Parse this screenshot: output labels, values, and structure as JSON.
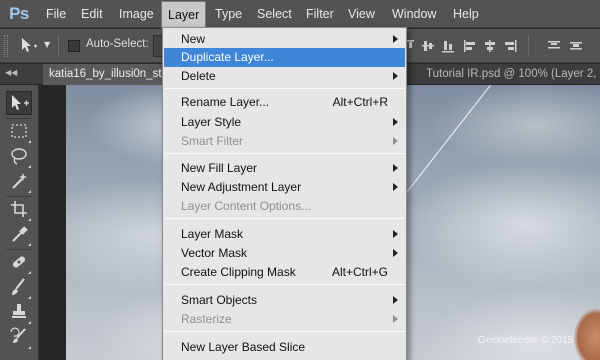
{
  "menubar": {
    "logo": "Ps",
    "items": [
      "File",
      "Edit",
      "Image",
      "Layer",
      "Type",
      "Select",
      "Filter",
      "View",
      "Window",
      "Help"
    ],
    "active": "Layer"
  },
  "options_bar": {
    "auto_select_label": "Auto-Select:"
  },
  "tabs": [
    {
      "label": "katia16_by_illusi0n_st",
      "active": true
    },
    {
      "label": "Tutorial IR.psd @ 100% (Layer 2,",
      "active": false
    }
  ],
  "layer_menu": {
    "items": [
      {
        "label": "New",
        "shortcut": "",
        "submenu": true,
        "state": "normal"
      },
      {
        "label": "Duplicate Layer...",
        "shortcut": "",
        "submenu": false,
        "state": "highlighted"
      },
      {
        "label": "Delete",
        "shortcut": "",
        "submenu": true,
        "state": "normal"
      },
      {
        "label": "Rename Layer...",
        "shortcut": "Alt+Ctrl+R",
        "submenu": false,
        "state": "normal"
      },
      {
        "label": "Layer Style",
        "shortcut": "",
        "submenu": true,
        "state": "normal"
      },
      {
        "label": "Smart Filter",
        "shortcut": "",
        "submenu": true,
        "state": "disabled"
      },
      {
        "label": "New Fill Layer",
        "shortcut": "",
        "submenu": true,
        "state": "normal"
      },
      {
        "label": "New Adjustment Layer",
        "shortcut": "",
        "submenu": true,
        "state": "normal"
      },
      {
        "label": "Layer Content Options...",
        "shortcut": "",
        "submenu": false,
        "state": "disabled"
      },
      {
        "label": "Layer Mask",
        "shortcut": "",
        "submenu": true,
        "state": "normal"
      },
      {
        "label": "Vector Mask",
        "shortcut": "",
        "submenu": true,
        "state": "normal"
      },
      {
        "label": "Create Clipping Mask",
        "shortcut": "Alt+Ctrl+G",
        "submenu": false,
        "state": "normal"
      },
      {
        "label": "Smart Objects",
        "shortcut": "",
        "submenu": true,
        "state": "normal"
      },
      {
        "label": "Rasterize",
        "shortcut": "",
        "submenu": true,
        "state": "disabled"
      },
      {
        "label": "New Layer Based Slice",
        "shortcut": "",
        "submenu": false,
        "state": "normal"
      }
    ]
  },
  "toolbar": {
    "tools": [
      "move-tool",
      "marquee-tool",
      "lasso-tool",
      "magic-wand-tool",
      "crop-tool",
      "eyedropper-tool",
      "healing-brush-tool",
      "brush-tool",
      "clone-stamp-tool",
      "history-brush-tool"
    ]
  },
  "watermark": "Geekiefeeder © 2015",
  "colors": {
    "ui_gray": "#535353",
    "menu_bg": "#e6e6e6",
    "highlight": "#3f86d8",
    "ps_logo": "#9ec7ea"
  }
}
